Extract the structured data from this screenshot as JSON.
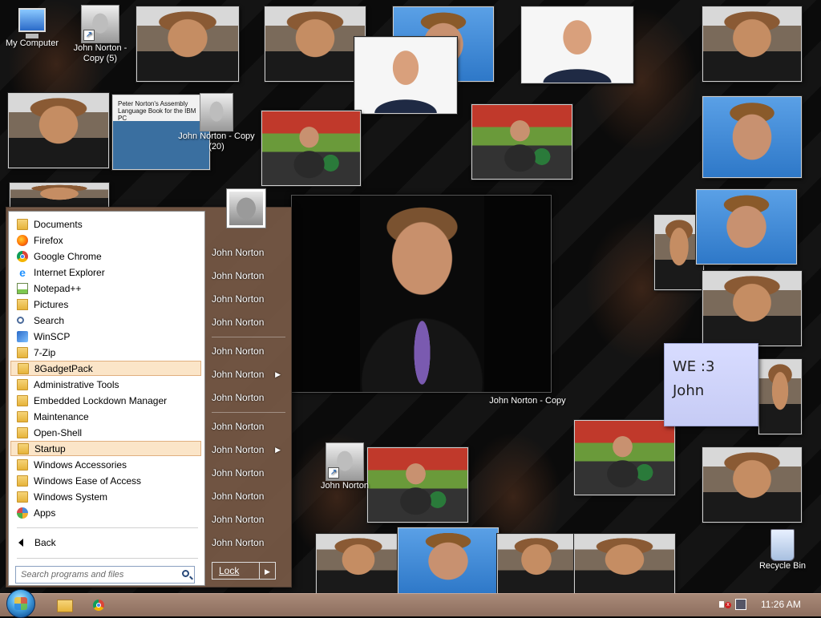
{
  "desktop": {
    "icons": [
      {
        "label": "My Computer"
      },
      {
        "label": "John Norton - Copy (5)"
      },
      {
        "label": "John Norton - Copy"
      },
      {
        "label": "John Norton - Copy (20)"
      },
      {
        "label": "John Norton"
      },
      {
        "label": "Recycle Bin"
      }
    ],
    "book_title": "Peter Norton's Assembly Language Book for the IBM PC",
    "note_text": "WE :3\nJohn"
  },
  "start_menu": {
    "programs": [
      {
        "label": "Documents",
        "icon": "folder-icon"
      },
      {
        "label": "Firefox",
        "icon": "firefox-icon"
      },
      {
        "label": "Google Chrome",
        "icon": "chrome-icon"
      },
      {
        "label": "Internet Explorer",
        "icon": "internet-explorer-icon"
      },
      {
        "label": "Notepad++",
        "icon": "notepad-icon"
      },
      {
        "label": "Pictures",
        "icon": "pictures-icon"
      },
      {
        "label": "Search",
        "icon": "search-icon"
      },
      {
        "label": "WinSCP",
        "icon": "winscp-icon"
      },
      {
        "label": "7-Zip",
        "icon": "folder-icon"
      },
      {
        "label": "8GadgetPack",
        "icon": "folder-icon",
        "highlighted": true
      },
      {
        "label": "Administrative Tools",
        "icon": "folder-icon"
      },
      {
        "label": "Embedded Lockdown Manager",
        "icon": "folder-icon"
      },
      {
        "label": "Maintenance",
        "icon": "folder-icon"
      },
      {
        "label": "Open-Shell",
        "icon": "folder-icon"
      },
      {
        "label": "Startup",
        "icon": "folder-icon",
        "highlighted": true
      },
      {
        "label": "Windows Accessories",
        "icon": "folder-icon"
      },
      {
        "label": "Windows Ease of Access",
        "icon": "folder-icon"
      },
      {
        "label": "Windows System",
        "icon": "folder-icon"
      },
      {
        "label": "Apps",
        "icon": "apps-icon"
      }
    ],
    "back_label": "Back",
    "search_placeholder": "Search programs and files",
    "right_items": [
      {
        "label": "John Norton"
      },
      {
        "label": "John Norton"
      },
      {
        "label": "John Norton"
      },
      {
        "label": "John Norton"
      },
      {
        "label": "John Norton"
      },
      {
        "label": "John Norton",
        "submenu": true
      },
      {
        "label": "John Norton"
      },
      {
        "label": "John Norton"
      },
      {
        "label": "John Norton",
        "submenu": true
      },
      {
        "label": "John Norton"
      },
      {
        "label": "John Norton"
      },
      {
        "label": "John Norton"
      },
      {
        "label": "John Norton"
      }
    ],
    "lock_label": "Lock"
  },
  "taskbar": {
    "clock": "11:26 AM"
  }
}
